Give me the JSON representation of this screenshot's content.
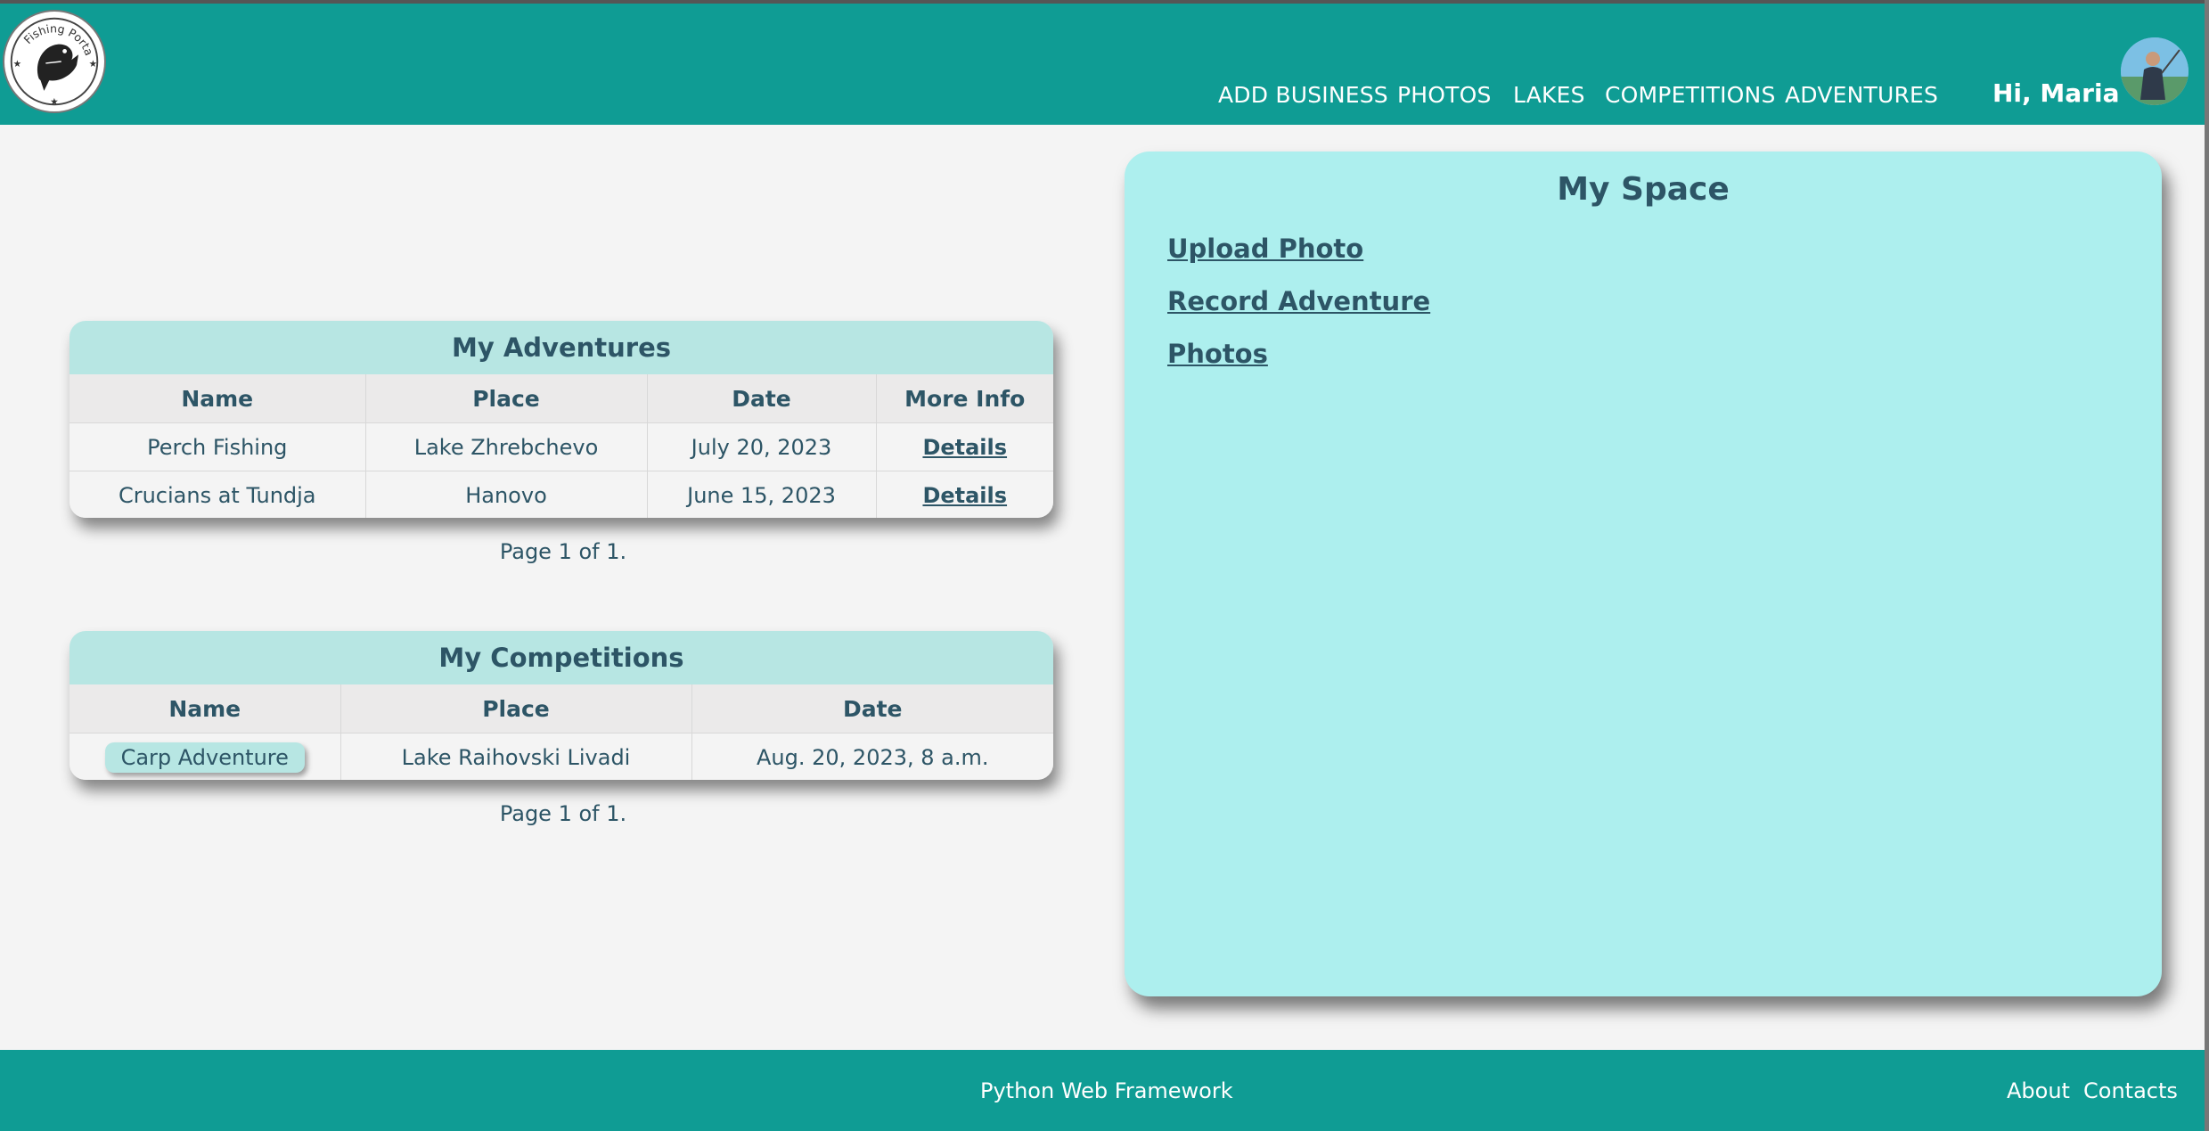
{
  "header": {
    "logo_text": "Fishing Portal",
    "nav": [
      "ADD BUSINESS",
      "PHOTOS",
      "LAKES",
      "COMPETITIONS",
      "ADVENTURES"
    ],
    "greeting": "Hi, Maria"
  },
  "adventures": {
    "title": "My Adventures",
    "columns": [
      "Name",
      "Place",
      "Date",
      "More Info"
    ],
    "rows": [
      {
        "name": "Perch Fishing",
        "place": "Lake Zhrebchevo",
        "date": "July 20, 2023",
        "info": "Details"
      },
      {
        "name": "Crucians at Tundja",
        "place": "Hanovo",
        "date": "June 15, 2023",
        "info": "Details"
      }
    ],
    "pager": "Page 1 of 1."
  },
  "competitions": {
    "title": "My Competitions",
    "columns": [
      "Name",
      "Place",
      "Date"
    ],
    "rows": [
      {
        "name": "Carp Adventure",
        "place": "Lake Raihovski Livadi",
        "date": "Aug. 20, 2023, 8 a.m."
      }
    ],
    "pager": "Page 1 of 1."
  },
  "myspace": {
    "title": "My Space",
    "links": [
      "Upload Photo",
      "Record Adventure",
      "Photos"
    ]
  },
  "footer": {
    "center": "Python Web Framework",
    "links": [
      "About",
      "Contacts"
    ]
  },
  "colors": {
    "header": "#0f9c94",
    "panel": "#adefee",
    "table_title": "#b7e6e3",
    "text": "#2d5566"
  }
}
